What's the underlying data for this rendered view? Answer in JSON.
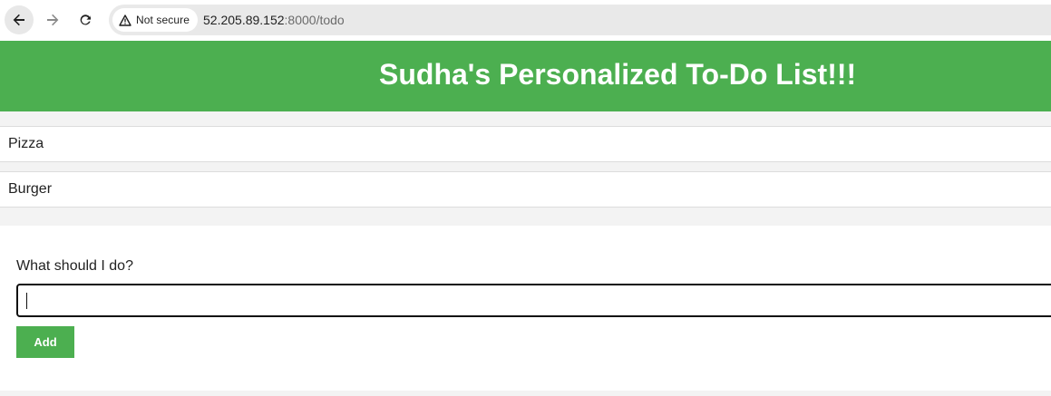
{
  "browser": {
    "security_label": "Not secure",
    "url_host": "52.205.89.152",
    "url_path": ":8000/todo",
    "icons": {
      "back": "arrow-left-icon",
      "forward": "arrow-right-icon",
      "reload": "reload-icon",
      "security": "warning-triangle-icon"
    }
  },
  "page": {
    "title": "Sudha's Personalized To-Do List!!!",
    "accent_color": "#4caf50",
    "todos": [
      {
        "text": "Pizza"
      },
      {
        "text": "Burger"
      }
    ],
    "form": {
      "label": "What should I do?",
      "input_value": "",
      "add_label": "Add"
    }
  }
}
